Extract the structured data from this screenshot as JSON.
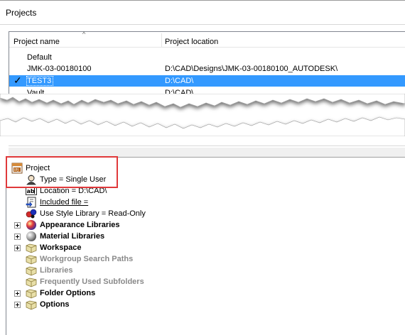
{
  "window": {
    "title": "Projects"
  },
  "projects_list": {
    "columns": {
      "name": "Project name",
      "location": "Project location"
    },
    "sort_indicator": "^",
    "rows": [
      {
        "name": "Default",
        "location": "",
        "active": false,
        "selected": false
      },
      {
        "name": "JMK-03-00180100",
        "location": "D:\\CAD\\Designs\\JMK-03-00180100_AUTODESK\\",
        "active": false,
        "selected": false
      },
      {
        "name": "TEST3",
        "location": "D:\\CAD\\",
        "active": true,
        "selected": true
      },
      {
        "name": "Vault",
        "location": "D:\\CAD\\",
        "active": false,
        "selected": false
      }
    ],
    "active_mark": "✓"
  },
  "tree": {
    "root": {
      "label": "Project",
      "icon": "project-ipj-icon"
    },
    "properties": [
      {
        "label": "Type = Single User",
        "icon": "single-user-icon"
      },
      {
        "label": "Location = D:\\CAD\\",
        "icon": "text-field-icon"
      },
      {
        "label": "Included file = ",
        "icon": "included-file-icon"
      },
      {
        "label": "Use Style Library = Read-Only",
        "icon": "style-library-icon"
      }
    ],
    "nodes": [
      {
        "label": "Appearance Libraries",
        "icon": "appearance-sphere-icon",
        "expandable": true,
        "enabled": true
      },
      {
        "label": "Material Libraries",
        "icon": "material-sphere-icon",
        "expandable": true,
        "enabled": true
      },
      {
        "label": "Workspace",
        "icon": "folder-icon",
        "expandable": true,
        "enabled": true
      },
      {
        "label": "Workgroup Search Paths",
        "icon": "folder-icon",
        "expandable": false,
        "enabled": false
      },
      {
        "label": "Libraries",
        "icon": "folder-icon",
        "expandable": false,
        "enabled": false
      },
      {
        "label": "Frequently Used Subfolders",
        "icon": "folder-icon",
        "expandable": false,
        "enabled": false
      },
      {
        "label": "Folder Options",
        "icon": "folder-icon",
        "expandable": true,
        "enabled": true
      },
      {
        "label": "Options",
        "icon": "folder-icon",
        "expandable": true,
        "enabled": true
      }
    ]
  },
  "colors": {
    "selection": "#3399ff",
    "highlight_box": "#e0393b",
    "disabled_text": "#8a8a8a"
  }
}
